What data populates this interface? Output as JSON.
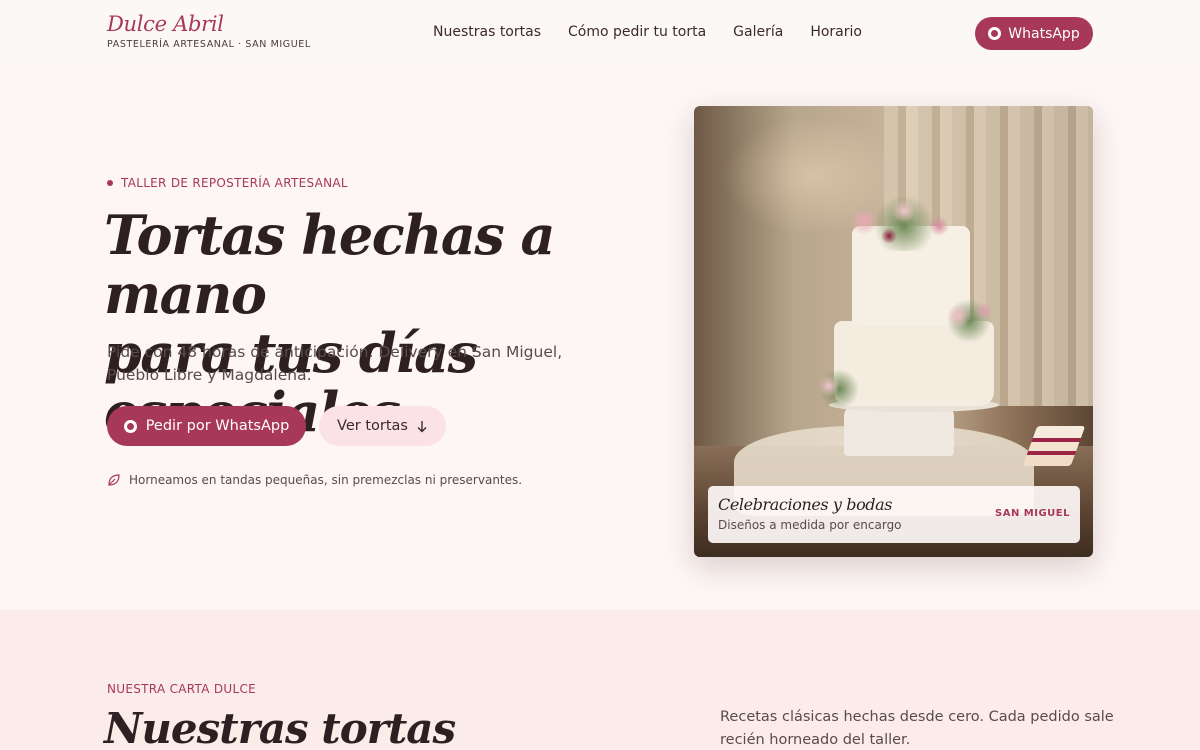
{
  "header": {
    "brand_name": "Dulce Abril",
    "brand_tagline": "PASTELERÍA ARTESANAL · SAN MIGUEL",
    "nav": [
      "Nuestras tortas",
      "Cómo pedir tu torta",
      "Galería",
      "Horario"
    ],
    "whatsapp_label": "WhatsApp"
  },
  "hero": {
    "eyebrow": "TALLER DE REPOSTERÍA ARTESANAL",
    "title_line1": "Tortas hechas a mano",
    "title_line2": "para tus días especiales.",
    "subtitle": "Pide con 48 horas de anticipación. Delivery en San Miguel, Pueblo Libre y Magdalena.",
    "primary_button": "Pedir por WhatsApp",
    "secondary_button": "Ver tortas",
    "secondary_icon": "arrow-down-icon",
    "note": "Horneamos en tandas pequeñas, sin premezclas ni preservantes.",
    "note_icon": "leaf-icon",
    "image_card": {
      "title": "Celebraciones y bodas",
      "subtitle": "Diseños a medida por encargo",
      "location": "SAN MIGUEL"
    }
  },
  "section": {
    "eyebrow": "NUESTRA CARTA DULCE",
    "title": "Nuestras tortas",
    "description": "Recetas clásicas hechas desde cero. Cada pedido sale recién horneado del taller."
  },
  "colors": {
    "accent": "#a8385a",
    "background": "#fdf6f4",
    "section_background": "#fbece9",
    "secondary_button": "#fbe2e6"
  }
}
